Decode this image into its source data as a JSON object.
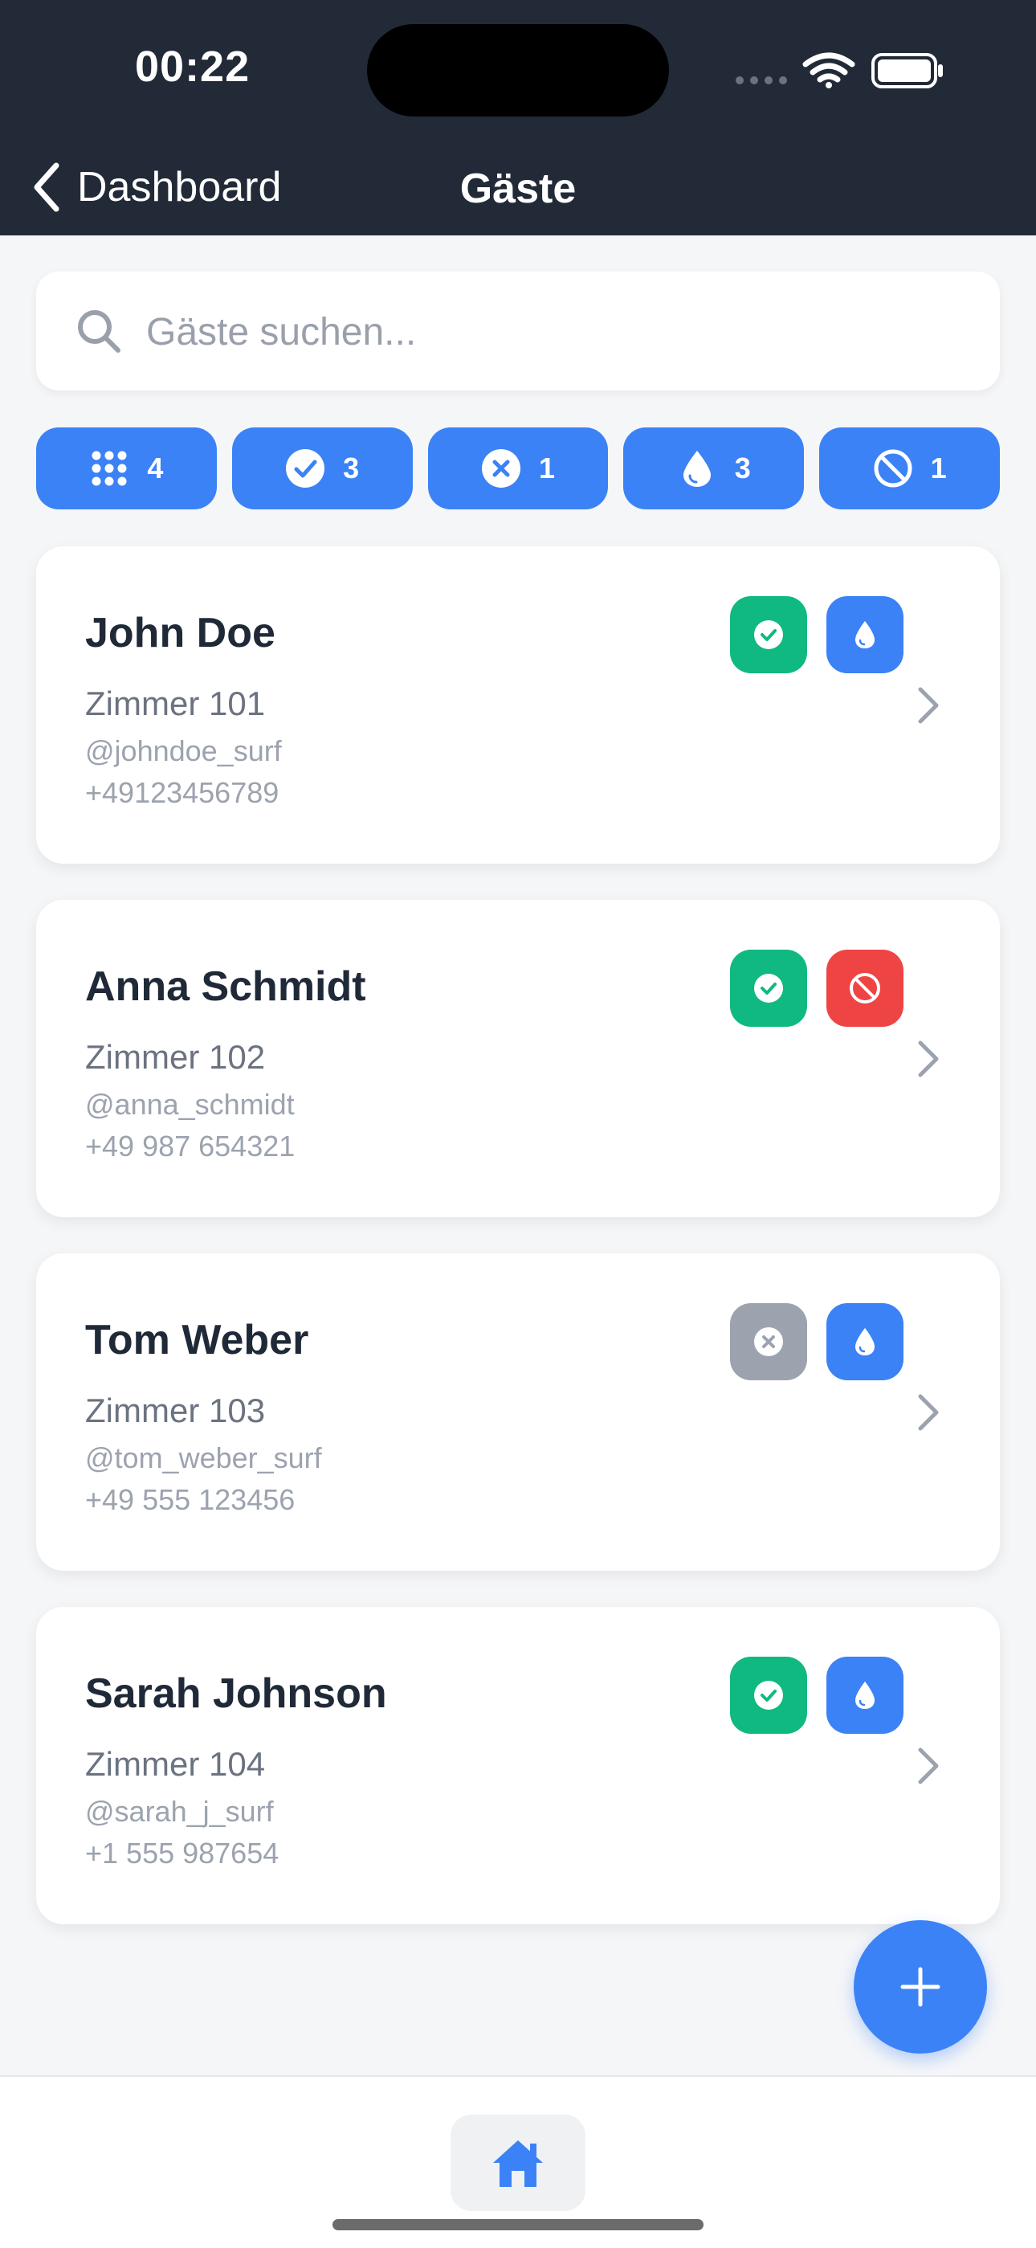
{
  "status_bar": {
    "time": "00:22"
  },
  "header": {
    "back_label": "Dashboard",
    "title": "Gäste"
  },
  "search": {
    "placeholder": "Gäste suchen..."
  },
  "filters": [
    {
      "icon": "grid-icon",
      "count": "4"
    },
    {
      "icon": "check-circle-icon",
      "count": "3"
    },
    {
      "icon": "x-circle-icon",
      "count": "1"
    },
    {
      "icon": "drop-icon",
      "count": "3"
    },
    {
      "icon": "ban-icon",
      "count": "1"
    }
  ],
  "guests": [
    {
      "name": "John Doe",
      "room": "Zimmer 101",
      "handle": "@johndoe_surf",
      "phone": "+49123456789",
      "badges": [
        {
          "icon": "check-icon",
          "color": "#10b981"
        },
        {
          "icon": "drop-icon",
          "color": "#3b82f6"
        }
      ]
    },
    {
      "name": "Anna Schmidt",
      "room": "Zimmer 102",
      "handle": "@anna_schmidt",
      "phone": "+49 987 654321",
      "badges": [
        {
          "icon": "check-icon",
          "color": "#10b981"
        },
        {
          "icon": "ban-icon",
          "color": "#ef4444"
        }
      ]
    },
    {
      "name": "Tom Weber",
      "room": "Zimmer 103",
      "handle": "@tom_weber_surf",
      "phone": "+49 555 123456",
      "badges": [
        {
          "icon": "x-icon",
          "color": "#9ca3af"
        },
        {
          "icon": "drop-icon",
          "color": "#3b82f6"
        }
      ]
    },
    {
      "name": "Sarah Johnson",
      "room": "Zimmer 104",
      "handle": "@sarah_j_surf",
      "phone": "+1 555 987654",
      "badges": [
        {
          "icon": "check-icon",
          "color": "#10b981"
        },
        {
          "icon": "drop-icon",
          "color": "#3b82f6"
        }
      ]
    }
  ],
  "fab": {
    "icon": "plus-icon"
  },
  "tabbar": {
    "active": "home-icon"
  },
  "colors": {
    "header_bg": "#222a38",
    "accent": "#3b82f6",
    "success": "#10b981",
    "danger": "#ef4444",
    "muted": "#9ca3af"
  }
}
